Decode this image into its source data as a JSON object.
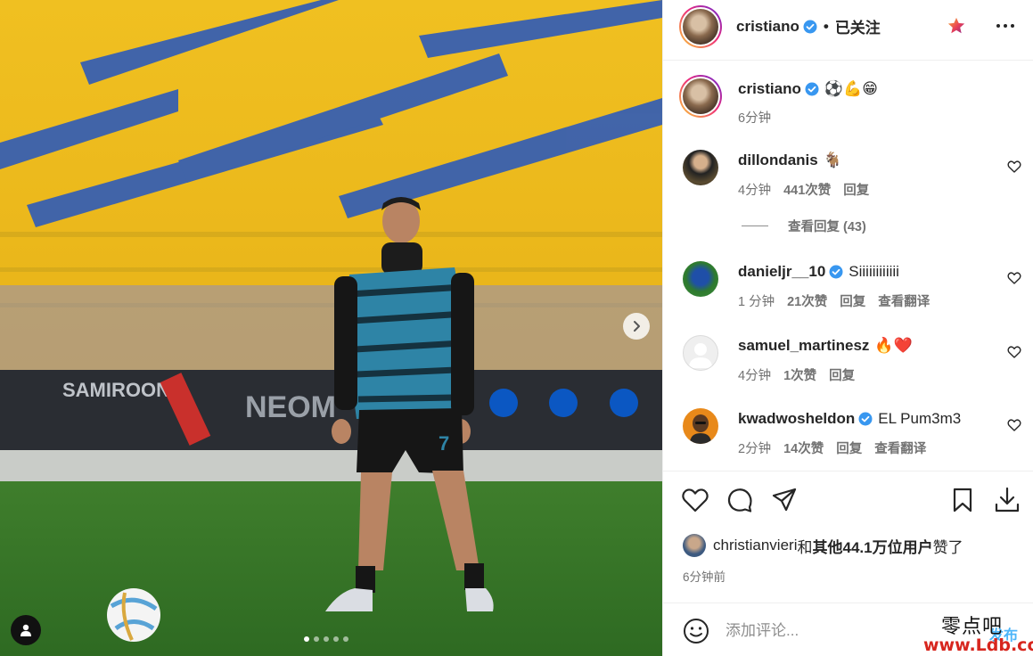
{
  "post": {
    "slide_count": 5,
    "active_slide": 1
  },
  "header": {
    "username": "cristiano",
    "separator": "•",
    "follow_status": "已关注"
  },
  "caption": {
    "username": "cristiano",
    "text": "⚽💪😁",
    "time": "6分钟"
  },
  "comments": [
    {
      "username": "dillondanis",
      "verified": false,
      "text": "🐐",
      "time": "4分钟",
      "likes": "441次赞",
      "reply": "回复",
      "translate": ""
    },
    {
      "username": "danieljr__10",
      "verified": true,
      "text": "Siiiiiiiiiiii",
      "time": "1 分钟",
      "likes": "21次赞",
      "reply": "回复",
      "translate": "查看翻译"
    },
    {
      "username": "samuel_martinesz",
      "verified": false,
      "text": "🔥❤️",
      "time": "4分钟",
      "likes": "1次赞",
      "reply": "回复",
      "translate": ""
    },
    {
      "username": "kwadwosheldon",
      "verified": true,
      "text": "EL Pum3m3",
      "time": "2分钟",
      "likes": "14次赞",
      "reply": "回复",
      "translate": "查看翻译"
    }
  ],
  "view_replies": "查看回复 (43)",
  "likes": {
    "user": "christianvieri",
    "conj": "和",
    "others": "其他44.1万位用户",
    "suffix": "赞了"
  },
  "posted_ago": "6分钟前",
  "comment_box": {
    "placeholder": "添加评论...",
    "post_label": "发布"
  },
  "watermark": {
    "line1": "零点吧",
    "line2": "www.Ldb.cc"
  },
  "icons": {
    "verified": "verified-badge-icon",
    "star": "favorite-star-icon",
    "more": "more-options-icon",
    "heart": "heart-icon",
    "comment": "comment-icon",
    "share": "share-icon",
    "save": "bookmark-icon",
    "download": "download-icon",
    "emoji": "emoji-icon",
    "tag": "user-tag-icon",
    "next": "chevron-right-icon"
  },
  "colors": {
    "verified_blue": "#3897f0",
    "link_blue": "#4cb5f9",
    "muted_text": "#737373",
    "star_gradient": "#e94057"
  }
}
